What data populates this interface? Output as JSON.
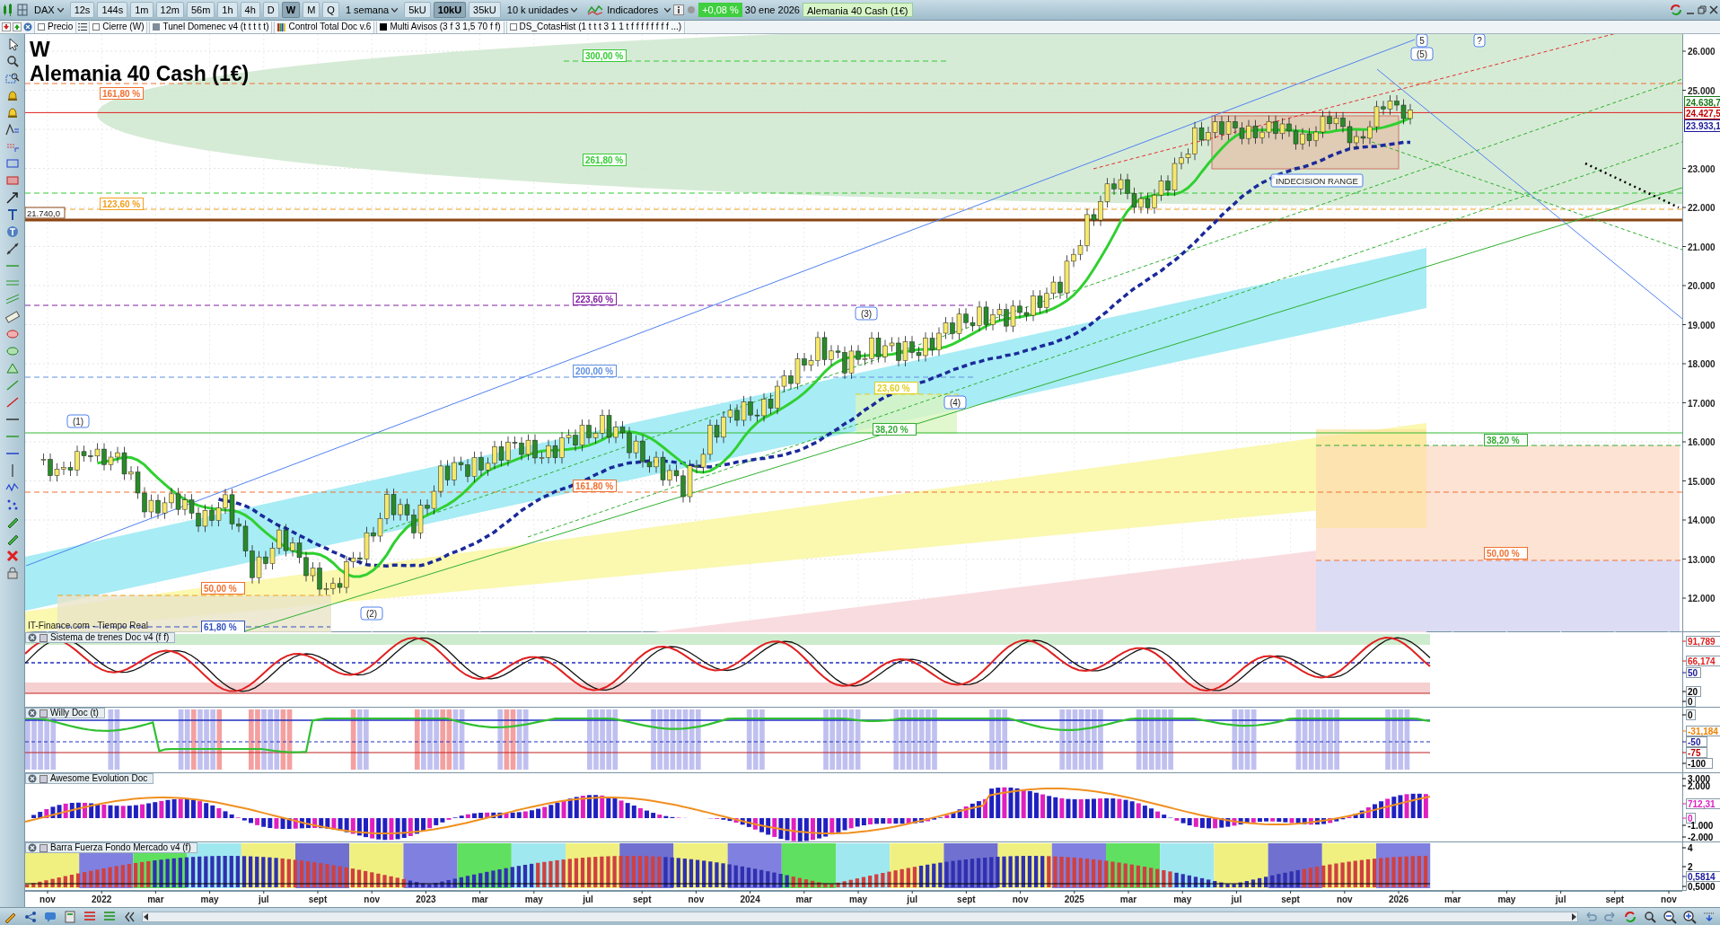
{
  "toolbar": {
    "symbol": "DAX",
    "timeframes": [
      {
        "label": "12s",
        "selected": false
      },
      {
        "label": "144s",
        "selected": false
      },
      {
        "label": "1m",
        "selected": false
      },
      {
        "label": "12m",
        "selected": false
      },
      {
        "label": "56m",
        "selected": false
      },
      {
        "label": "1h",
        "selected": false
      },
      {
        "label": "4h",
        "selected": false
      },
      {
        "label": "D",
        "selected": false
      },
      {
        "label": "W",
        "selected": true
      },
      {
        "label": "M",
        "selected": false
      },
      {
        "label": "Q",
        "selected": false
      }
    ],
    "period": "1 semana",
    "units": [
      {
        "label": "5kU",
        "selected": false
      },
      {
        "label": "10kU",
        "selected": true
      },
      {
        "label": "35kU",
        "selected": false
      }
    ],
    "units_dropdown": "10 k unidades",
    "indicators_button": "Indicadores",
    "change": "+0,08 %",
    "date": "30 ene 2026",
    "instrument": "Alemania 40 Cash (1€)"
  },
  "indicator_bar": [
    {
      "kind": "checkbox",
      "label": "Precio",
      "checked": false
    },
    {
      "kind": "list"
    },
    {
      "kind": "checkbox",
      "label": "Cierre (W)",
      "checked": false
    },
    {
      "kind": "swatch",
      "label": "Tunel Domenec v4 (t t t t t)",
      "color": "#7f8c99"
    },
    {
      "kind": "bars",
      "label": "Control Total Doc v.6"
    },
    {
      "kind": "swatch",
      "label": "Multi Avisos (3 f 3 1,5 70 f f)",
      "color": "#000000"
    },
    {
      "kind": "checkbox",
      "label": "DS_CotasHist (1 t t t 3 1 1 t f f f f f f f f ...)",
      "checked": false
    }
  ],
  "main_chart": {
    "timeframe_label": "W",
    "title": "Alemania 40 Cash (1€)",
    "source": "IT-Finance.com - Tiempo Real",
    "y_axis": [
      "26.000",
      "25.000",
      "23.000",
      "22.000",
      "21.000",
      "20.000",
      "19.000",
      "18.000",
      "17.000",
      "16.000",
      "15.000",
      "14.000",
      "13.000",
      "12.000"
    ],
    "x_axis": [
      "nov",
      "2022",
      "mar",
      "may",
      "jul",
      "sept",
      "nov",
      "2023",
      "mar",
      "may",
      "jul",
      "sept",
      "nov",
      "2024",
      "mar",
      "may",
      "jul",
      "sept",
      "nov",
      "2025",
      "mar",
      "may",
      "jul",
      "sept",
      "nov",
      "2026",
      "mar",
      "may",
      "jul",
      "sept",
      "nov"
    ],
    "fibonacci_labels": [
      {
        "label": "161,80 %",
        "color": "#f07030"
      },
      {
        "label": "300,00 %",
        "color": "#33cc33"
      },
      {
        "label": "261,80 %",
        "color": "#33cc33"
      },
      {
        "label": "123,60 %",
        "color": "#f0a020"
      },
      {
        "label": "223,60 %",
        "color": "#8020a0"
      },
      {
        "label": "200,00 %",
        "color": "#6090e0"
      },
      {
        "label": "161,80 %",
        "color": "#f07030"
      },
      {
        "label": "23,60 %",
        "color": "#e0d020"
      },
      {
        "label": "38,20 %",
        "color": "#33aa33"
      },
      {
        "label": "38,20 %",
        "color": "#33aa33"
      },
      {
        "label": "50,00 %",
        "color": "#f07030"
      },
      {
        "label": "50,00 %",
        "color": "#f07030"
      },
      {
        "label": "61,80 %",
        "color": "#3050c0"
      }
    ],
    "wave_labels": [
      "(1)",
      "(2)",
      "(3)",
      "(4)",
      "(5)",
      "5",
      "?"
    ],
    "range_label": "INDECISION RANGE",
    "level_label": "21.740,0",
    "price_tags": [
      {
        "text": "24.638,7",
        "color": "#1a7a1a"
      },
      {
        "text": "24.427,5",
        "color": "#c00000"
      },
      {
        "text": "23.933,1",
        "color": "#1a1a9a"
      }
    ]
  },
  "panels": [
    {
      "title": "Sistema de trenes Doc v4 (f f)",
      "labels": [
        {
          "text": "91,789",
          "color": "#e02020",
          "boxed": true
        },
        {
          "text": "66,174",
          "color": "#e02020",
          "boxed": true
        },
        {
          "text": "50",
          "color": "#1a1a9a",
          "boxed": true
        },
        {
          "text": "20",
          "color": "#000000",
          "boxed": true
        },
        {
          "text": "0",
          "color": "#000000",
          "boxed": true
        }
      ]
    },
    {
      "title": "Willy Doc (t)",
      "labels": [
        {
          "text": "0",
          "color": "#000000",
          "boxed": true
        },
        {
          "text": "-31,184",
          "color": "#f08000",
          "boxed": true
        },
        {
          "text": "-50",
          "color": "#1a1a9a",
          "boxed": true
        },
        {
          "text": "-75",
          "color": "#c00000",
          "boxed": true
        },
        {
          "text": "-100",
          "color": "#000000",
          "boxed": true
        }
      ]
    },
    {
      "title": "Awesome Evolution Doc",
      "labels": [
        {
          "text": "3.000",
          "color": "#000000",
          "boxed": false
        },
        {
          "text": "2.000",
          "color": "#000000",
          "boxed": false
        },
        {
          "text": "712,31",
          "color": "#e020c0",
          "boxed": true
        },
        {
          "text": "0",
          "color": "#e020c0",
          "boxed": true
        },
        {
          "text": "-1.000",
          "color": "#000000",
          "boxed": false
        },
        {
          "text": "-2.000",
          "color": "#000000",
          "boxed": false
        }
      ]
    },
    {
      "title": "Barra Fuerza Fondo Mercado v4 (f)",
      "labels": [
        {
          "text": "4",
          "color": "#000000",
          "boxed": false
        },
        {
          "text": "2",
          "color": "#000000",
          "boxed": false
        },
        {
          "text": "0,5814",
          "color": "#1a1a9a",
          "boxed": true
        },
        {
          "text": "0,5000",
          "color": "#000000",
          "boxed": true
        }
      ]
    }
  ]
}
